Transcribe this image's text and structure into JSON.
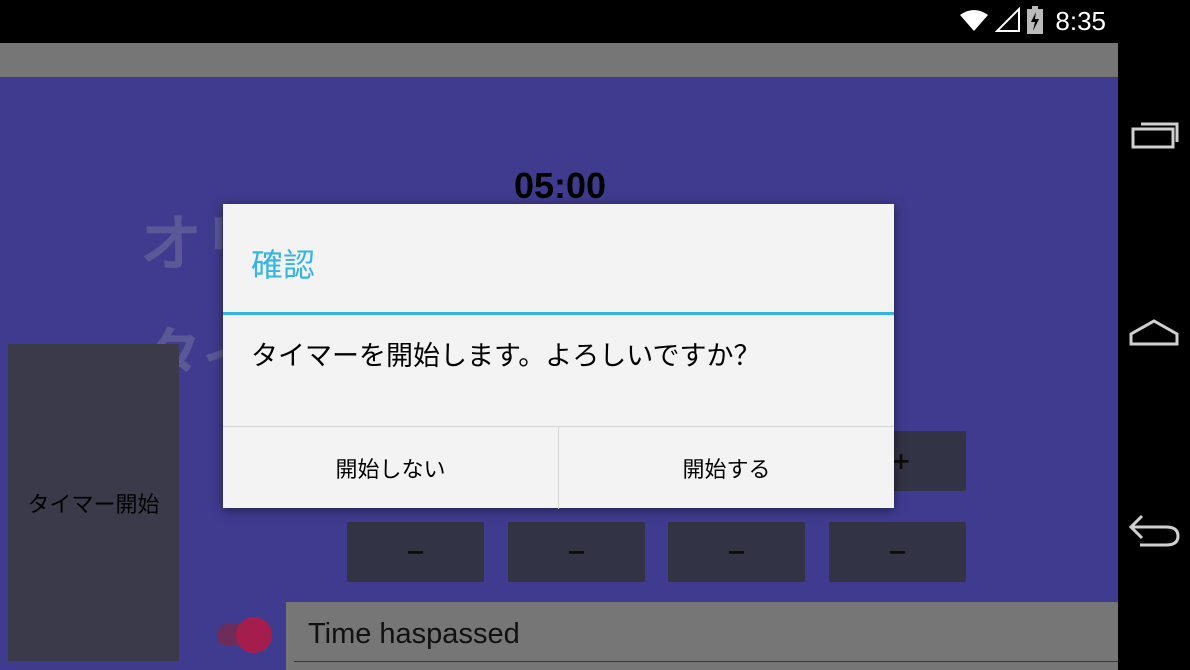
{
  "status_bar": {
    "time": "8:35",
    "icons": [
      "wifi-icon",
      "signal-icon",
      "battery-charging-icon"
    ]
  },
  "background": {
    "title_line1": "オリジナル",
    "title_line2": "タイマーを使う",
    "timer": "05:00",
    "start_button_label": "タイマー開始",
    "plus_label": "+",
    "minus_labels": [
      "−",
      "−",
      "−",
      "−"
    ],
    "time_field_value": "Time haspassed"
  },
  "dialog": {
    "title": "確認",
    "message": "タイマーを開始します。よろしいですか？",
    "negative_button": "開始しない",
    "positive_button": "開始する"
  },
  "nav_bar": {
    "icons": [
      "recent-apps-icon",
      "home-icon",
      "back-icon"
    ]
  },
  "colors": {
    "app_background": "#3f3c8f",
    "dialog_accent": "#33b5e5",
    "toggle_thumb": "#a51d4c"
  }
}
